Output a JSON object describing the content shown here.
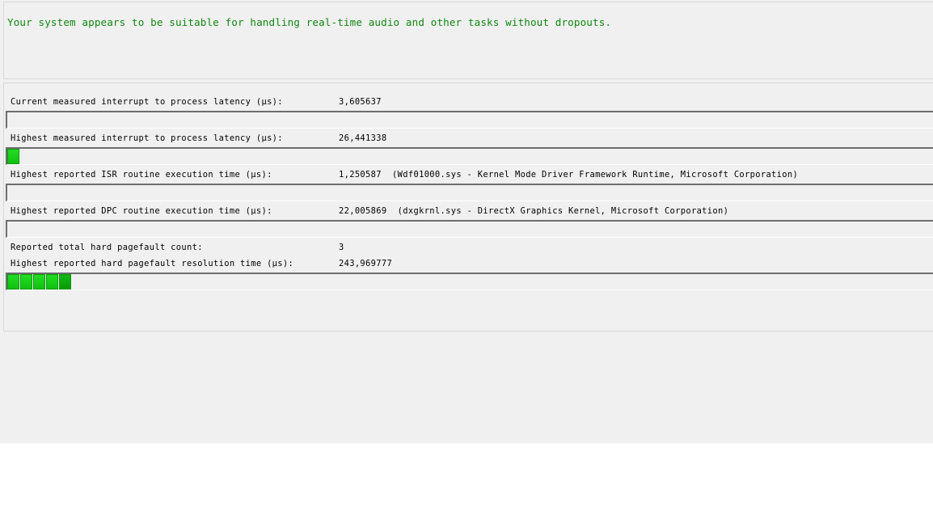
{
  "status_message": "Your system appears to be suitable for handling real-time audio and other tasks without dropouts.",
  "metrics": {
    "current_latency": {
      "label": "Current measured interrupt to process latency (µs):",
      "value": "3,605637",
      "bar_segments": 0
    },
    "highest_latency": {
      "label": "Highest measured interrupt to process latency (µs):",
      "value": "26,441338",
      "bar_segments": 1
    },
    "isr_time": {
      "label": "Highest reported ISR routine execution time (µs):",
      "value": "1,250587  (Wdf01000.sys - Kernel Mode Driver Framework Runtime, Microsoft Corporation)",
      "bar_segments": 0
    },
    "dpc_time": {
      "label": "Highest reported DPC routine execution time (µs):",
      "value": "22,005869  (dxgkrnl.sys - DirectX Graphics Kernel, Microsoft Corporation)",
      "bar_segments": 0
    },
    "pagefault_count": {
      "label": "Reported total hard pagefault count:",
      "value": "3"
    },
    "pagefault_time": {
      "label": "Highest reported hard pagefault resolution time (µs):",
      "value": "243,969777",
      "bar_segments": 5
    }
  },
  "colors": {
    "status_text": "#118811",
    "bar_fill": "#22dd22",
    "bar_fill_dark": "#0a9a0a"
  }
}
